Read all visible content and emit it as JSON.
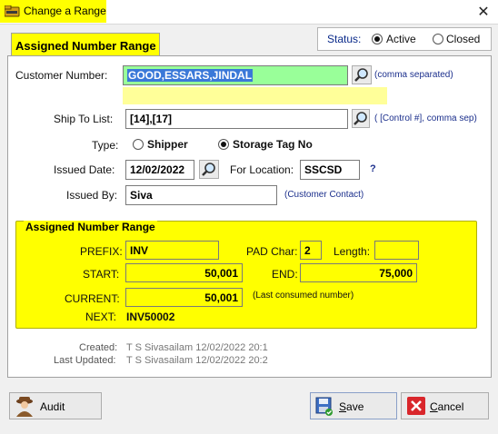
{
  "window": {
    "title": "Change a Range",
    "close_glyph": "✕"
  },
  "tab": {
    "label": "Assigned Number Range"
  },
  "status": {
    "label": "Status:",
    "options": [
      "Active",
      "Closed"
    ],
    "selected": "Active"
  },
  "form": {
    "customer_number": {
      "label": "Customer Number:",
      "value": "GOOD,ESSARS,JINDAL",
      "hint": "(comma separated)"
    },
    "ship_to": {
      "label": "Ship To List:",
      "value": "[14],[17]",
      "hint": "( [Control #], comma sep)"
    },
    "type": {
      "label": "Type:",
      "options": [
        "Shipper",
        "Storage Tag No"
      ],
      "selected": "Storage Tag No"
    },
    "issued_date": {
      "label": "Issued Date:",
      "value": "12/02/2022"
    },
    "for_location": {
      "label": "For Location:",
      "value": "SSCSD",
      "help": "?"
    },
    "issued_by": {
      "label": "Issued By:",
      "value": "Siva",
      "hint": "(Customer Contact)"
    }
  },
  "range": {
    "title": "Assigned Number Range",
    "prefix_label": "PREFIX:",
    "prefix": "INV",
    "pad_char_label": "PAD Char:",
    "pad_char": "2",
    "length_label": "Length:",
    "length": "",
    "start_label": "START:",
    "start": "50,001",
    "end_label": "END:",
    "end": "75,000",
    "current_label": "CURRENT:",
    "current": "50,001",
    "current_hint": "(Last consumed number)",
    "next_label": "NEXT:",
    "next": "INV50002"
  },
  "audit_info": {
    "created_label": "Created:",
    "created": "T S Sivasailam 12/02/2022 20:1",
    "updated_label": "Last Updated:",
    "updated": "T S Sivasailam 12/02/2022 20:2"
  },
  "buttons": {
    "audit": "Audit",
    "save": "Save",
    "cancel": "Cancel"
  },
  "colors": {
    "highlight": "#ffff00",
    "green_field": "#99ff99",
    "hint_blue": "#1b2f8c",
    "cancel_red": "#d9262b"
  }
}
